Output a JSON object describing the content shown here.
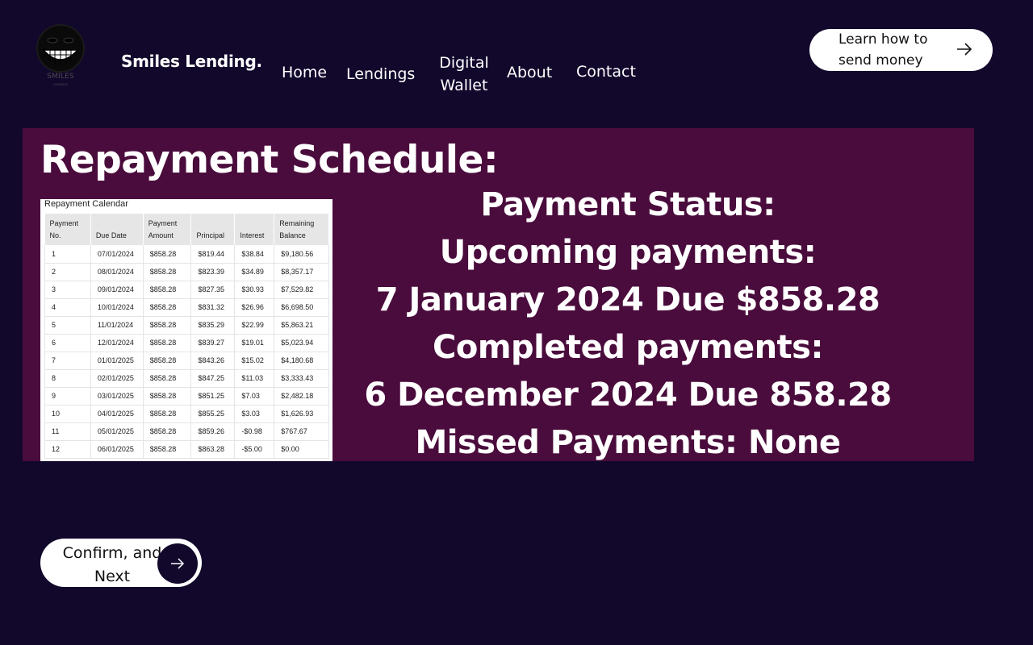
{
  "header": {
    "logo_text": "SMILES",
    "logo_subtext": "LENDING",
    "brand": "Smiles Lending.",
    "nav": [
      {
        "label": "Home"
      },
      {
        "label": "Lendings"
      },
      {
        "label": "Digital Wallet"
      },
      {
        "label": "About"
      },
      {
        "label": "Contact"
      }
    ],
    "cta_label": "Learn how to send money",
    "cta_icon": "arrow-right-icon"
  },
  "main": {
    "title": "Repayment Schedule:",
    "calendar": {
      "title": "Repayment Calendar",
      "columns": [
        "Payment No.",
        "Due Date",
        "Payment Amount",
        "Principal",
        "Interest",
        "Remaining Balance"
      ],
      "rows": [
        [
          "1",
          "07/01/2024",
          "$858.28",
          "$819.44",
          "$38.84",
          "$9,180.56"
        ],
        [
          "2",
          "08/01/2024",
          "$858.28",
          "$823.39",
          "$34.89",
          "$8,357.17"
        ],
        [
          "3",
          "09/01/2024",
          "$858.28",
          "$827.35",
          "$30.93",
          "$7,529.82"
        ],
        [
          "4",
          "10/01/2024",
          "$858.28",
          "$831.32",
          "$26.96",
          "$6,698.50"
        ],
        [
          "5",
          "11/01/2024",
          "$858.28",
          "$835.29",
          "$22.99",
          "$5,863.21"
        ],
        [
          "6",
          "12/01/2024",
          "$858.28",
          "$839.27",
          "$19.01",
          "$5,023.94"
        ],
        [
          "7",
          "01/01/2025",
          "$858.28",
          "$843.26",
          "$15.02",
          "$4,180.68"
        ],
        [
          "8",
          "02/01/2025",
          "$858.28",
          "$847.25",
          "$11.03",
          "$3,333.43"
        ],
        [
          "9",
          "03/01/2025",
          "$858.28",
          "$851.25",
          "$7.03",
          "$2,482.18"
        ],
        [
          "10",
          "04/01/2025",
          "$858.28",
          "$855.25",
          "$3.03",
          "$1,626.93"
        ],
        [
          "11",
          "05/01/2025",
          "$858.28",
          "$859.26",
          "-$0.98",
          "$767.67"
        ],
        [
          "12",
          "06/01/2025",
          "$858.28",
          "$863.28",
          "-$5.00",
          "$0.00"
        ]
      ]
    },
    "status": {
      "heading": "Payment Status:",
      "upcoming_label": "Upcoming payments:",
      "upcoming_value": "7 January 2024 Due $858.28",
      "completed_label": "Completed payments:",
      "completed_value": "6 December 2024 Due 858.28",
      "missed": "Missed Payments: None"
    }
  },
  "footer": {
    "confirm_label": "Confirm, and Next",
    "confirm_icon": "arrow-right-icon"
  },
  "colors": {
    "background": "#12082c",
    "panel": "#4a0c3c",
    "button": "#ffffff"
  }
}
